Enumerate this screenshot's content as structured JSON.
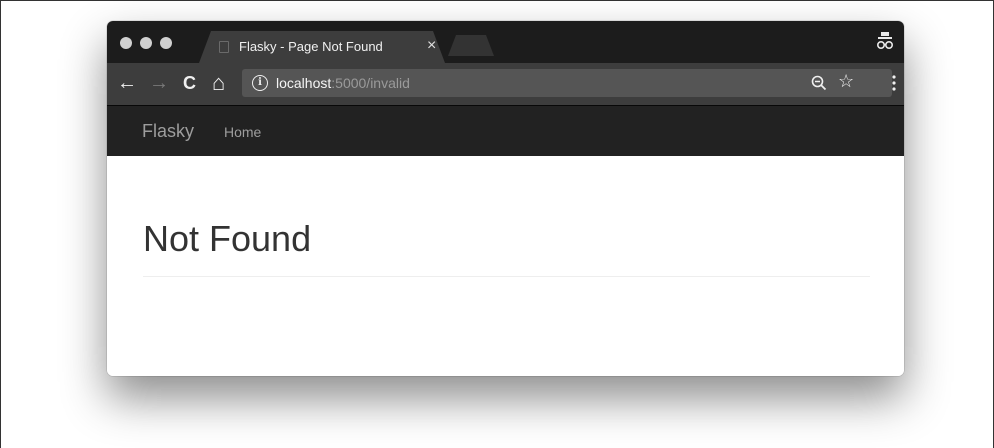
{
  "browser": {
    "tab_title": "Flasky - Page Not Found",
    "tab_close": "×",
    "nav": {
      "back": "←",
      "forward": "→",
      "reload": "C",
      "home": "⌂"
    },
    "url_info": "i",
    "url_host": "localhost",
    "url_rest": ":5000/invalid",
    "bookmark_star": "☆"
  },
  "navbar": {
    "brand": "Flasky",
    "links": [
      {
        "label": "Home"
      }
    ]
  },
  "page": {
    "heading": "Not Found"
  },
  "colors": {
    "titlebar": "#1c1c1c",
    "toolbar": "#3d3d3d",
    "omnibox": "#555555",
    "navbar": "#222222",
    "nav_text": "#9d9d9d",
    "heading": "#333333"
  }
}
